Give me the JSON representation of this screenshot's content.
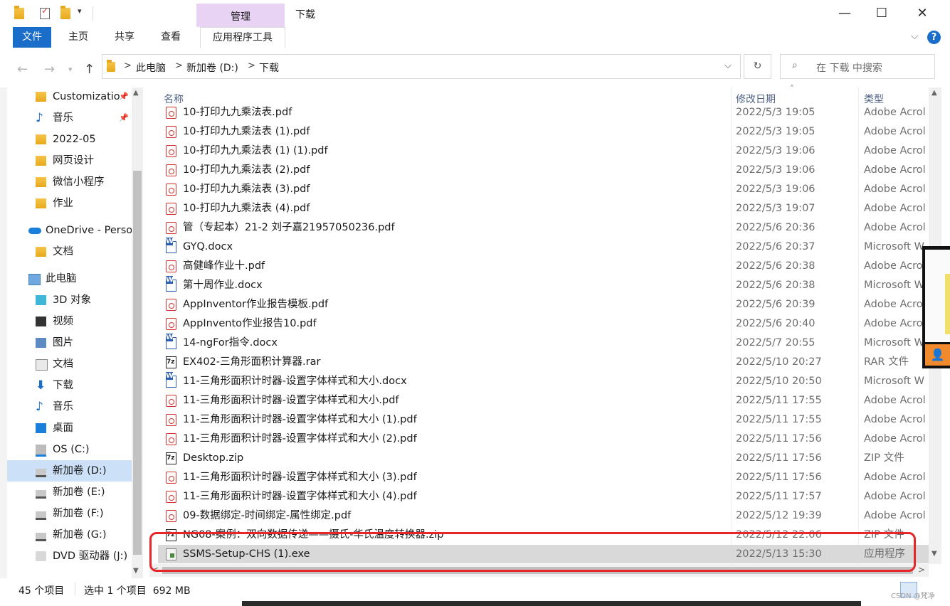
{
  "window": {
    "title": "下载",
    "context_tab": "管理",
    "minimize": "—",
    "maximize": "☐",
    "close": "✕"
  },
  "ribbon": {
    "file_tab": "文件",
    "tabs": [
      "主页",
      "共享",
      "查看"
    ],
    "app_tools_tab": "应用程序工具",
    "help": "?",
    "collapse": "⌵"
  },
  "address": {
    "crumbs": [
      "此电脑",
      "新加卷 (D:)",
      "下载"
    ],
    "search_placeholder": "在 下载 中搜索"
  },
  "sidebar": {
    "items": [
      {
        "label": "Customizatio",
        "icon": "folder",
        "pinned": true
      },
      {
        "label": "音乐",
        "icon": "music",
        "pinned": true
      },
      {
        "label": "2022-05",
        "icon": "folder",
        "pinned": false
      },
      {
        "label": "网页设计",
        "icon": "folder",
        "pinned": false
      },
      {
        "label": "微信小程序",
        "icon": "folder",
        "pinned": false
      },
      {
        "label": "作业",
        "icon": "folder",
        "pinned": false
      },
      {
        "label": "OneDrive - Perso",
        "icon": "cloud",
        "pinned": false
      },
      {
        "label": "文档",
        "icon": "folder",
        "pinned": false
      },
      {
        "label": "此电脑",
        "icon": "pc",
        "pinned": false
      },
      {
        "label": "3D 对象",
        "icon": "cube",
        "pinned": false
      },
      {
        "label": "视频",
        "icon": "video",
        "pinned": false
      },
      {
        "label": "图片",
        "icon": "picture",
        "pinned": false
      },
      {
        "label": "文档",
        "icon": "document",
        "pinned": false
      },
      {
        "label": "下载",
        "icon": "download",
        "pinned": false
      },
      {
        "label": "音乐",
        "icon": "music",
        "pinned": false
      },
      {
        "label": "桌面",
        "icon": "desktop",
        "pinned": false
      },
      {
        "label": "OS (C:)",
        "icon": "drive-os",
        "pinned": false
      },
      {
        "label": "新加卷 (D:)",
        "icon": "drive",
        "pinned": false,
        "selected": true
      },
      {
        "label": "新加卷 (E:)",
        "icon": "drive",
        "pinned": false
      },
      {
        "label": "新加卷 (F:)",
        "icon": "drive",
        "pinned": false
      },
      {
        "label": "新加卷 (G:)",
        "icon": "drive",
        "pinned": false
      },
      {
        "label": "DVD 驱动器 (J:)",
        "icon": "dvd",
        "pinned": false
      }
    ]
  },
  "columns": {
    "name": "名称",
    "date": "修改日期",
    "type": "类型"
  },
  "files": [
    {
      "name": "10-打印九九乘法表.pdf",
      "date": "2022/5/3 19:05",
      "type": "Adobe Acrol",
      "icon": "pdf"
    },
    {
      "name": "10-打印九九乘法表 (1).pdf",
      "date": "2022/5/3 19:05",
      "type": "Adobe Acrol",
      "icon": "pdf"
    },
    {
      "name": "10-打印九九乘法表 (1) (1).pdf",
      "date": "2022/5/3 19:06",
      "type": "Adobe Acrol",
      "icon": "pdf"
    },
    {
      "name": "10-打印九九乘法表 (2).pdf",
      "date": "2022/5/3 19:06",
      "type": "Adobe Acrol",
      "icon": "pdf"
    },
    {
      "name": "10-打印九九乘法表 (3).pdf",
      "date": "2022/5/3 19:06",
      "type": "Adobe Acrol",
      "icon": "pdf"
    },
    {
      "name": "10-打印九九乘法表 (4).pdf",
      "date": "2022/5/3 19:07",
      "type": "Adobe Acrol",
      "icon": "pdf"
    },
    {
      "name": "管（专起本）21-2 刘子嘉21957050236.pdf",
      "date": "2022/5/6 20:36",
      "type": "Adobe Acrol",
      "icon": "pdf"
    },
    {
      "name": "GYQ.docx",
      "date": "2022/5/6 20:37",
      "type": "Microsoft W",
      "icon": "doc"
    },
    {
      "name": "高健峰作业十.pdf",
      "date": "2022/5/6 20:38",
      "type": "Adobe Acro",
      "icon": "pdf"
    },
    {
      "name": "第十周作业.docx",
      "date": "2022/5/6 20:38",
      "type": "Microsoft W",
      "icon": "doc"
    },
    {
      "name": "AppInventor作业报告模板.pdf",
      "date": "2022/5/6 20:39",
      "type": "Adobe Acro",
      "icon": "pdf"
    },
    {
      "name": "AppInvento作业报告10.pdf",
      "date": "2022/5/6 20:40",
      "type": "Adobe Acro",
      "icon": "pdf"
    },
    {
      "name": "14-ngFor指令.docx",
      "date": "2022/5/7 20:55",
      "type": "Microsoft W",
      "icon": "doc"
    },
    {
      "name": "EX402-三角形面积计算器.rar",
      "date": "2022/5/10 20:27",
      "type": "RAR 文件",
      "icon": "zip"
    },
    {
      "name": "11-三角形面积计时器-设置字体样式和大小.docx",
      "date": "2022/5/10 20:50",
      "type": "Microsoft W",
      "icon": "doc"
    },
    {
      "name": "11-三角形面积计时器-设置字体样式和大小.pdf",
      "date": "2022/5/11 17:55",
      "type": "Adobe Acrol",
      "icon": "pdf"
    },
    {
      "name": "11-三角形面积计时器-设置字体样式和大小 (1).pdf",
      "date": "2022/5/11 17:55",
      "type": "Adobe Acrol",
      "icon": "pdf"
    },
    {
      "name": "11-三角形面积计时器-设置字体样式和大小 (2).pdf",
      "date": "2022/5/11 17:56",
      "type": "Adobe Acrol",
      "icon": "pdf"
    },
    {
      "name": "Desktop.zip",
      "date": "2022/5/11 17:56",
      "type": "ZIP 文件",
      "icon": "zip"
    },
    {
      "name": "11-三角形面积计时器-设置字体样式和大小 (3).pdf",
      "date": "2022/5/11 17:56",
      "type": "Adobe Acrol",
      "icon": "pdf"
    },
    {
      "name": "11-三角形面积计时器-设置字体样式和大小 (4).pdf",
      "date": "2022/5/11 17:57",
      "type": "Adobe Acrol",
      "icon": "pdf"
    },
    {
      "name": "09-数据绑定-时间绑定-属性绑定.pdf",
      "date": "2022/5/12 19:39",
      "type": "Adobe Acrol",
      "icon": "pdf"
    },
    {
      "name": "NG08-案例：双向数据传递——摄氏-华氏温度转换器.zip",
      "date": "2022/5/12 22:06",
      "type": "ZIP 文件",
      "icon": "zip"
    },
    {
      "name": "SSMS-Setup-CHS (1).exe",
      "date": "2022/5/13 15:30",
      "type": "应用程序",
      "icon": "exe",
      "selected": true
    }
  ],
  "status": {
    "count": "45 个项目",
    "selection": "选中 1 个项目  692 MB"
  },
  "watermark": "CSDN @梵净"
}
